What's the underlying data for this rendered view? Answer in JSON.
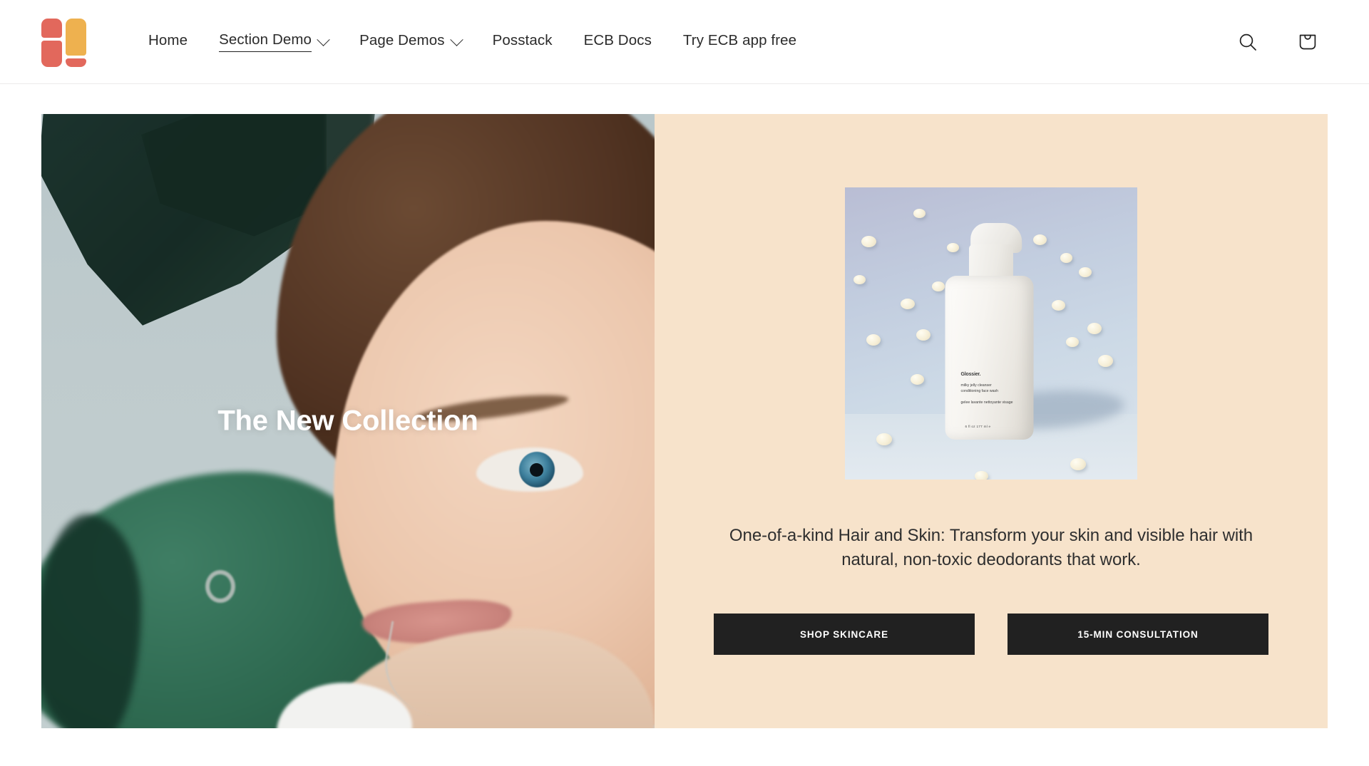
{
  "header": {
    "logo_name": "grid-logo",
    "logo_colors": {
      "red": "#E2685C",
      "yellow": "#EEB14F"
    },
    "nav": [
      {
        "label": "Home",
        "has_dropdown": false,
        "active": false
      },
      {
        "label": "Section Demo",
        "has_dropdown": true,
        "active": true
      },
      {
        "label": "Page Demos",
        "has_dropdown": true,
        "active": false
      },
      {
        "label": "Posstack",
        "has_dropdown": false,
        "active": false
      },
      {
        "label": "ECB Docs",
        "has_dropdown": false,
        "active": false
      },
      {
        "label": "Try ECB app free",
        "has_dropdown": false,
        "active": false
      }
    ],
    "actions": [
      {
        "name": "search-icon",
        "label": "Search"
      },
      {
        "name": "cart-icon",
        "label": "Cart"
      }
    ]
  },
  "hero": {
    "caption": "The New Collection",
    "image_alt": "Close-up portrait of a woman with blue eyes beside green monstera leaves",
    "panel": {
      "background_color": "#F7E3CB",
      "product": {
        "brand": "Glossier.",
        "name": "milky jelly cleanser",
        "subtitle": "conditioning face wash",
        "secondary": "gelee lavante nettoyante visage",
        "volume": "6 fl oz   177 ml ℮",
        "alt": "White pump bottle on blue gradient background with cream blobs"
      },
      "description": "One-of-a-kind Hair and Skin: Transform your skin and visible hair with natural, non-toxic deodorants that work.",
      "buttons": [
        {
          "label": "SHOP SKINCARE",
          "name": "shop-skincare-button"
        },
        {
          "label": "15-MIN CONSULTATION",
          "name": "consultation-button"
        }
      ]
    }
  }
}
